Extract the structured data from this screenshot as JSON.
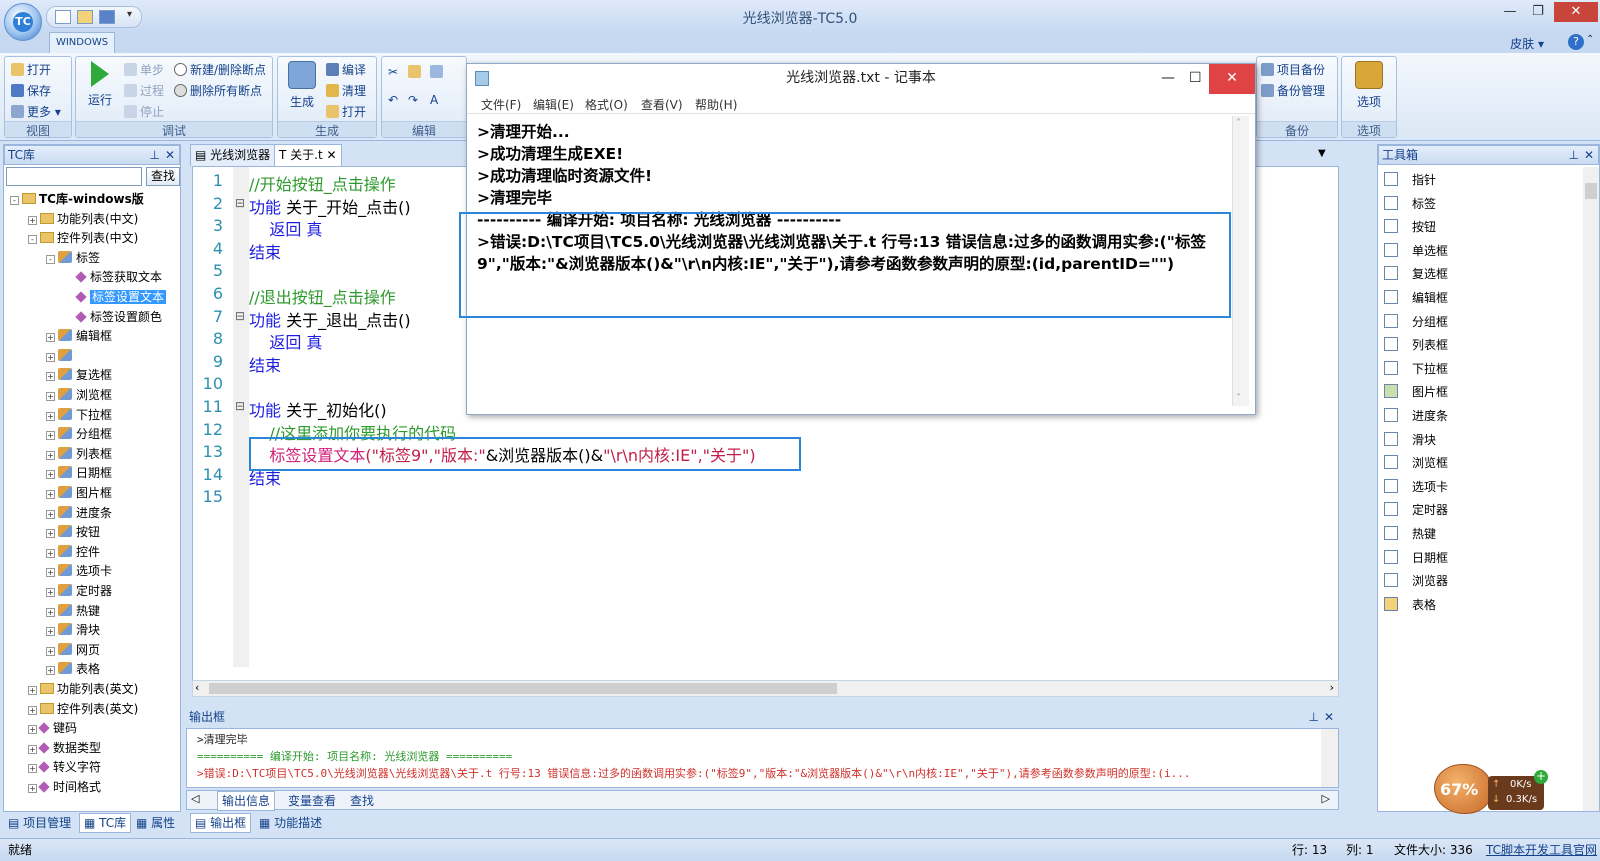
{
  "app": {
    "title": "光线浏览器-TC5.0",
    "ribbon_tab": "WINDOWS",
    "skin": "皮肤",
    "help": "?"
  },
  "ribbon": {
    "view": {
      "open": "打开",
      "save": "保存",
      "more": "更多",
      "label": "视图"
    },
    "debug": {
      "run": "运行",
      "step": "单步",
      "over": "过程",
      "stop": "停止",
      "toggle_bp": "新建/删除断点",
      "del_bp": "删除所有断点",
      "label": "调试"
    },
    "build": {
      "generate": "生成",
      "compile": "编译",
      "clean": "清理",
      "open": "打开",
      "label": "生成"
    },
    "edit": {
      "label": "编辑"
    },
    "backup": {
      "backup": "项目备份",
      "manage": "备份管理",
      "label": "备份"
    },
    "options": {
      "options": "选项",
      "label": "选项"
    }
  },
  "left_pane": {
    "title": "TC库",
    "search_btn": "查找",
    "search_value": "",
    "tree": [
      {
        "text": "TC库-windows版",
        "level": 0,
        "type": "root"
      },
      {
        "text": "功能列表(中文)",
        "level": 1,
        "type": "folder",
        "exp": "+"
      },
      {
        "text": "控件列表(中文)",
        "level": 1,
        "type": "folder",
        "exp": "-"
      },
      {
        "text": "标签",
        "level": 2,
        "type": "ctl",
        "exp": "-"
      },
      {
        "text": "标签获取文本",
        "level": 3,
        "type": "item"
      },
      {
        "text": "标签设置文本",
        "level": 3,
        "type": "item",
        "selected": true
      },
      {
        "text": "标签设置颜色",
        "level": 3,
        "type": "item"
      },
      {
        "text": "编辑框",
        "level": 2,
        "type": "ctl",
        "exp": "+"
      },
      {
        "text": "",
        "level": 2,
        "type": "ctl",
        "exp": "+"
      },
      {
        "text": "复选框",
        "level": 2,
        "type": "ctl",
        "exp": "+"
      },
      {
        "text": "浏览框",
        "level": 2,
        "type": "ctl",
        "exp": "+"
      },
      {
        "text": "下拉框",
        "level": 2,
        "type": "ctl",
        "exp": "+"
      },
      {
        "text": "分组框",
        "level": 2,
        "type": "ctl",
        "exp": "+"
      },
      {
        "text": "列表框",
        "level": 2,
        "type": "ctl",
        "exp": "+"
      },
      {
        "text": "日期框",
        "level": 2,
        "type": "ctl",
        "exp": "+"
      },
      {
        "text": "图片框",
        "level": 2,
        "type": "ctl",
        "exp": "+"
      },
      {
        "text": "进度条",
        "level": 2,
        "type": "ctl",
        "exp": "+"
      },
      {
        "text": "按钮",
        "level": 2,
        "type": "ctl",
        "exp": "+"
      },
      {
        "text": "控件",
        "level": 2,
        "type": "ctl",
        "exp": "+"
      },
      {
        "text": "选项卡",
        "level": 2,
        "type": "ctl",
        "exp": "+"
      },
      {
        "text": "定时器",
        "level": 2,
        "type": "ctl",
        "exp": "+"
      },
      {
        "text": "热键",
        "level": 2,
        "type": "ctl",
        "exp": "+"
      },
      {
        "text": "滑块",
        "level": 2,
        "type": "ctl",
        "exp": "+"
      },
      {
        "text": "网页",
        "level": 2,
        "type": "ctl",
        "exp": "+"
      },
      {
        "text": "表格",
        "level": 2,
        "type": "ctl",
        "exp": "+"
      },
      {
        "text": "功能列表(英文)",
        "level": 1,
        "type": "folder",
        "exp": "+"
      },
      {
        "text": "控件列表(英文)",
        "level": 1,
        "type": "folder",
        "exp": "+"
      },
      {
        "text": "键码",
        "level": 1,
        "type": "item",
        "exp": "+"
      },
      {
        "text": "数据类型",
        "level": 1,
        "type": "item",
        "exp": "+"
      },
      {
        "text": "转义字符",
        "level": 1,
        "type": "item",
        "exp": "+"
      },
      {
        "text": "时间格式",
        "level": 1,
        "type": "item",
        "exp": "+"
      }
    ],
    "tabs": [
      "项目管理",
      "TC库",
      "属性"
    ]
  },
  "doc_tabs": [
    "光线浏览器",
    "关于.t"
  ],
  "code": [
    {
      "n": "1",
      "parts": [
        {
          "t": "//开始按钮_点击操作",
          "c": "cm"
        }
      ]
    },
    {
      "n": "2",
      "fold": true,
      "parts": [
        {
          "t": "功能",
          "c": "kw"
        },
        {
          "t": " 关于_开始_点击()",
          "c": ""
        }
      ]
    },
    {
      "n": "3",
      "parts": [
        {
          "t": "    返回 真",
          "c": "kw"
        }
      ]
    },
    {
      "n": "4",
      "parts": [
        {
          "t": "结束",
          "c": "kw"
        }
      ]
    },
    {
      "n": "5",
      "parts": []
    },
    {
      "n": "6",
      "parts": [
        {
          "t": "//退出按钮_点击操作",
          "c": "cm"
        }
      ]
    },
    {
      "n": "7",
      "fold": true,
      "parts": [
        {
          "t": "功能",
          "c": "kw"
        },
        {
          "t": " 关于_退出_点击()",
          "c": ""
        }
      ]
    },
    {
      "n": "8",
      "parts": [
        {
          "t": "    返回 真",
          "c": "kw"
        }
      ]
    },
    {
      "n": "9",
      "parts": [
        {
          "t": "结束",
          "c": "kw"
        }
      ]
    },
    {
      "n": "10",
      "parts": []
    },
    {
      "n": "11",
      "fold": true,
      "parts": [
        {
          "t": "功能",
          "c": "kw"
        },
        {
          "t": " 关于_初始化()",
          "c": ""
        }
      ]
    },
    {
      "n": "12",
      "parts": [
        {
          "t": "    //这里添加你要执行的代码",
          "c": "cm"
        }
      ]
    },
    {
      "n": "13",
      "parts": [
        {
          "t": "    标签设置文本",
          "c": "fn"
        },
        {
          "t": "(\"标签9\",\"版本:\"",
          "c": "st"
        },
        {
          "t": "&浏览器版本()&",
          "c": ""
        },
        {
          "t": "\"\\r\\n内核:IE\",\"关于\")",
          "c": "st"
        }
      ]
    },
    {
      "n": "14",
      "parts": [
        {
          "t": "结束",
          "c": "kw"
        }
      ]
    },
    {
      "n": "15",
      "parts": []
    }
  ],
  "output": {
    "title": "输出框",
    "lines": [
      {
        "t": ">清理完毕",
        "c": "#222"
      },
      {
        "t": "========== 编译开始: 项目名称: 光线浏览器 ==========",
        "c": "#2e9a2e"
      },
      {
        "t": ">错误:D:\\TC项目\\TC5.0\\光线浏览器\\光线浏览器\\关于.t 行号:13 错误信息:过多的函数调用实参:(\"标签9\",\"版本:\"&浏览器版本()&\"\\r\\n内核:IE\",\"关于\"),请参考函数参数声明的原型:(i...",
        "c": "#d0302a"
      }
    ],
    "tabs": [
      "输出信息",
      "变量查看",
      "查找"
    ],
    "pane_tabs": [
      "输出框",
      "功能描述"
    ]
  },
  "toolbox": {
    "title": "工具箱",
    "items": [
      "指针",
      "标签",
      "按钮",
      "单选框",
      "复选框",
      "编辑框",
      "分组框",
      "列表框",
      "下拉框",
      "图片框",
      "进度条",
      "滑块",
      "浏览框",
      "选项卡",
      "定时器",
      "热键",
      "日期框",
      "浏览器",
      "表格"
    ]
  },
  "notepad": {
    "title": "光线浏览器.txt - 记事本",
    "menu": [
      "文件(F)",
      "编辑(E)",
      "格式(O)",
      "查看(V)",
      "帮助(H)"
    ],
    "lines": [
      ">清理开始...",
      ">成功清理生成EXE!",
      ">成功清理临时资源文件!",
      ">清理完毕",
      "---------- 编译开始: 项目名称: 光线浏览器 ----------",
      ">错误:D:\\TC项目\\TC5.0\\光线浏览器\\光线浏览器\\关于.t 行号:13 错误信息:过多的函数调用实参:(\"标签",
      "9\",\"版本:\"&浏览器版本()&\"\\r\\n内核:IE\",\"关于\"),请参考函数参数声明的原型:(id,parentID=\"\")"
    ]
  },
  "status": {
    "ready": "就绪",
    "row": "行: 13",
    "col": "列: 1",
    "filesize": "文件大小: 336",
    "brand": "TC脚本开发工具官网"
  },
  "widget": {
    "percent": "67%",
    "up": "0K/s",
    "down": "0.3K/s"
  }
}
